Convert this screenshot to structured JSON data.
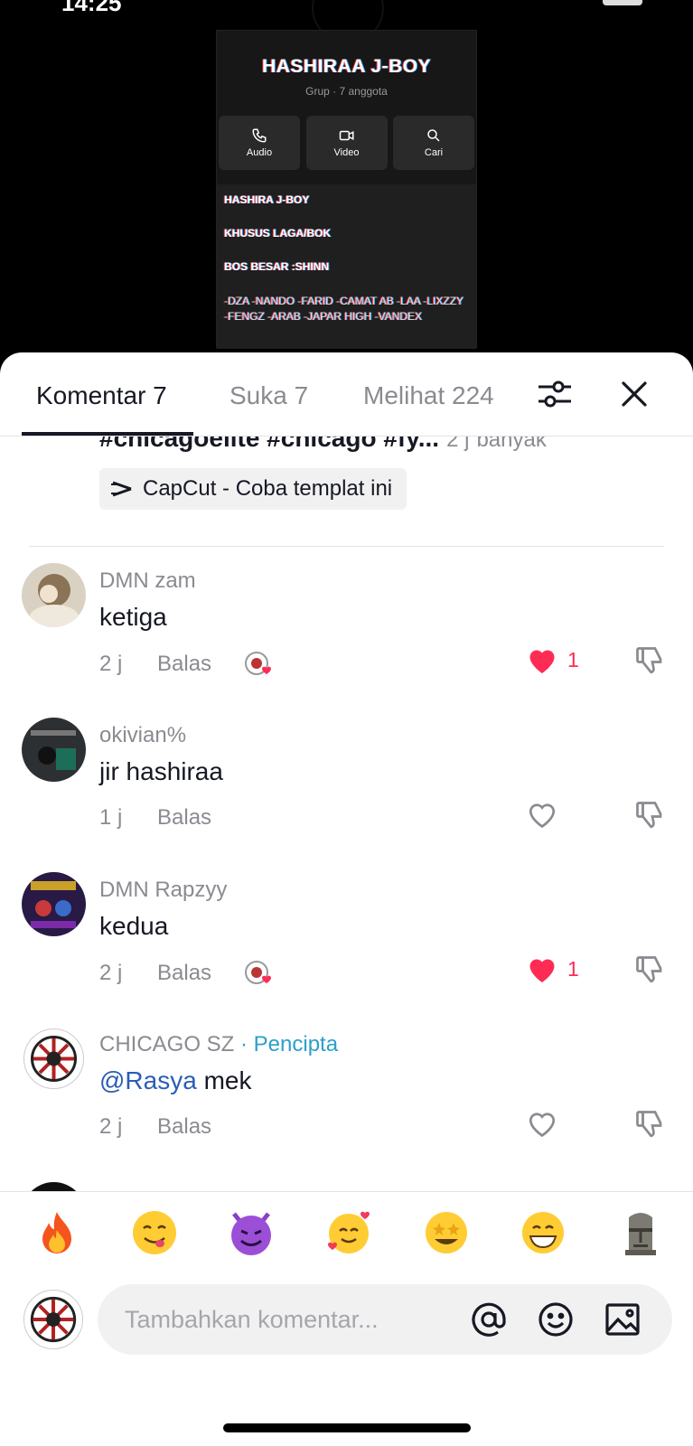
{
  "status_bar": {
    "time": "14:25"
  },
  "group_card": {
    "title": "HASHIRAA J-BOY",
    "subtitle": "Grup · 7 anggota",
    "actions": [
      {
        "label": "Audio",
        "icon": "phone-icon"
      },
      {
        "label": "Video",
        "icon": "video-icon"
      },
      {
        "label": "Cari",
        "icon": "search-icon"
      }
    ],
    "description": {
      "line1": "HASHIRA J-BOY",
      "line2": "KHUSUS LAGA/BOK",
      "line3": "BOS BESAR :SHINN",
      "members": "-DZA  -NANDO  -FARID   -CAMAT AB -LAA -LIXZZY  -FENGZ -ARAB  -JAPAR HIGH -VANDEX"
    }
  },
  "tabs": [
    {
      "label": "Komentar 7",
      "active": true
    },
    {
      "label": "Suka 7",
      "active": false
    },
    {
      "label": "Melihat 224",
      "active": false
    }
  ],
  "caption": {
    "tail_text": "#chicagoelite #chicago #fy...",
    "time": "2 j",
    "more": "banyak",
    "capcut_label": "CapCut - Coba templat ini"
  },
  "comments": [
    {
      "username": "DMN zam",
      "creator_tag": "",
      "mention": "",
      "text": "ketiga",
      "time": "2 j",
      "reply": "Balas",
      "liked": true,
      "likes": "1",
      "creator_liked": true
    },
    {
      "username": "okivian%",
      "creator_tag": "",
      "mention": "",
      "text": "jir hashiraa",
      "time": "1 j",
      "reply": "Balas",
      "liked": false,
      "likes": "",
      "creator_liked": false
    },
    {
      "username": "DMN   Rapzyy",
      "creator_tag": "",
      "mention": "",
      "text": "kedua",
      "time": "2 j",
      "reply": "Balas",
      "liked": true,
      "likes": "1",
      "creator_liked": true
    },
    {
      "username": "CHICAGO SZ",
      "creator_tag": " · Pencipta",
      "mention": "@Rasya",
      "text": " mek",
      "time": "2 j",
      "reply": "Balas",
      "liked": false,
      "likes": "",
      "creator_liked": false
    }
  ],
  "emojis": [
    "🔥",
    "😋",
    "😈",
    "🥰",
    "🤩",
    "😁",
    "🗿"
  ],
  "input": {
    "placeholder": "Tambahkan komentar..."
  },
  "colors": {
    "like_red": "#fe2c55",
    "creator_blue": "#2aa0c9",
    "mention_blue": "#2b5db5",
    "muted": "#8a8b91"
  }
}
